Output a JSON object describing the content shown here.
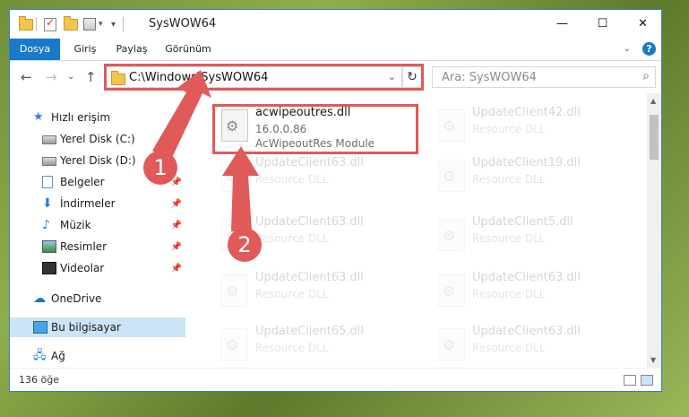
{
  "window": {
    "title": "SysWOW64",
    "controls": {
      "minimize": "—",
      "maximize": "☐",
      "close": "✕"
    }
  },
  "ribbon": {
    "tabs": [
      "Dosya",
      "Giriş",
      "Paylaş",
      "Görünüm"
    ],
    "help": "?"
  },
  "address": {
    "path": "C:\\Windows\\SysWOW64",
    "search_placeholder": "Ara: SysWOW64"
  },
  "nav": {
    "items": [
      {
        "label": "Hızlı erişim",
        "icon": "star-icon",
        "pinned": false
      },
      {
        "label": "Yerel Disk (C:)",
        "icon": "disk-icon",
        "pinned": false
      },
      {
        "label": "Yerel Disk (D:)",
        "icon": "disk-icon",
        "pinned": false
      },
      {
        "label": "Belgeler",
        "icon": "documents-icon",
        "pinned": true
      },
      {
        "label": "İndirmeler",
        "icon": "download-icon",
        "pinned": true
      },
      {
        "label": "Müzik",
        "icon": "music-icon",
        "pinned": true
      },
      {
        "label": "Resimler",
        "icon": "pictures-icon",
        "pinned": true
      },
      {
        "label": "Videolar",
        "icon": "video-icon",
        "pinned": true
      },
      {
        "label": "OneDrive",
        "icon": "cloud-icon",
        "pinned": false
      },
      {
        "label": "Bu bilgisayar",
        "icon": "computer-icon",
        "pinned": false,
        "selected": true
      },
      {
        "label": "Ağ",
        "icon": "network-icon",
        "pinned": false
      }
    ]
  },
  "files": {
    "highlighted": {
      "name": "acwipeoutres.dll",
      "version": "16.0.0.86",
      "description": "AcWipeoutRes Module"
    },
    "left": [
      {
        "name": "UpdateClient63.dll",
        "type": "Resource DLL"
      },
      {
        "name": "UpdateClient63.dll",
        "type": "Resource DLL"
      },
      {
        "name": "UpdateClient63.dll",
        "type": "Resource DLL"
      },
      {
        "name": "UpdateClient65.dll",
        "type": "Resource DLL"
      }
    ],
    "right": [
      {
        "name": "UpdateClient42.dll",
        "type": "Resource DLL"
      },
      {
        "name": "UpdateClient19.dll",
        "type": "Resource DLL"
      },
      {
        "name": "UpdateClient5.dll",
        "type": "Resource DLL"
      },
      {
        "name": "UpdateClient63.dll",
        "type": "Resource DLL"
      },
      {
        "name": "UpdateClient63.dll",
        "type": "Resource DLL"
      }
    ]
  },
  "status": {
    "count": "136 öğe"
  },
  "callouts": [
    "1",
    "2"
  ],
  "colors": {
    "accent": "#1979ca",
    "highlight": "#e05a5a",
    "selection": "#cce4f7"
  }
}
